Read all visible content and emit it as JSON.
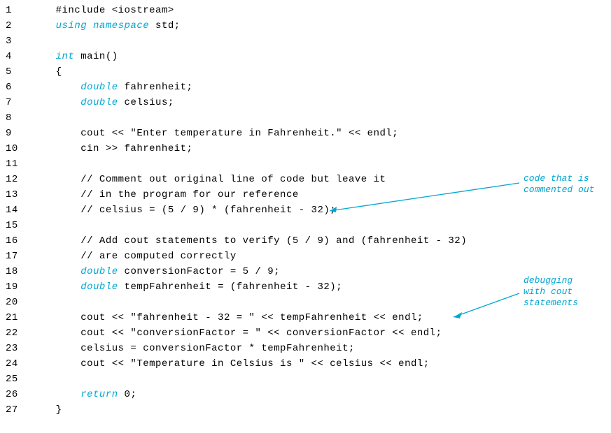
{
  "code": {
    "lines": [
      {
        "n": "1",
        "plain": "#include <iostream>"
      },
      {
        "n": "2",
        "pre": "",
        "kw": "using namespace",
        "post": " std;"
      },
      {
        "n": "3",
        "plain": ""
      },
      {
        "n": "4",
        "pre": "",
        "kw": "int",
        "post": " main()"
      },
      {
        "n": "5",
        "plain": "{"
      },
      {
        "n": "6",
        "pre": "    ",
        "kw": "double",
        "post": " fahrenheit;"
      },
      {
        "n": "7",
        "pre": "    ",
        "kw": "double",
        "post": " celsius;"
      },
      {
        "n": "8",
        "plain": ""
      },
      {
        "n": "9",
        "plain": "    cout << \"Enter temperature in Fahrenheit.\" << endl;"
      },
      {
        "n": "10",
        "plain": "    cin >> fahrenheit;"
      },
      {
        "n": "11",
        "plain": ""
      },
      {
        "n": "12",
        "plain": "    // Comment out original line of code but leave it"
      },
      {
        "n": "13",
        "plain": "    // in the program for our reference"
      },
      {
        "n": "14",
        "plain": "    // celsius = (5 / 9) * (fahrenheit - 32);"
      },
      {
        "n": "15",
        "plain": ""
      },
      {
        "n": "16",
        "plain": "    // Add cout statements to verify (5 / 9) and (fahrenheit - 32)"
      },
      {
        "n": "17",
        "plain": "    // are computed correctly"
      },
      {
        "n": "18",
        "pre": "    ",
        "kw": "double",
        "post": " conversionFactor = 5 / 9;"
      },
      {
        "n": "19",
        "pre": "    ",
        "kw": "double",
        "post": " tempFahrenheit = (fahrenheit - 32);"
      },
      {
        "n": "20",
        "plain": ""
      },
      {
        "n": "21",
        "plain": "    cout << \"fahrenheit - 32 = \" << tempFahrenheit << endl;"
      },
      {
        "n": "22",
        "plain": "    cout << \"conversionFactor = \" << conversionFactor << endl;"
      },
      {
        "n": "23",
        "plain": "    celsius = conversionFactor * tempFahrenheit;"
      },
      {
        "n": "24",
        "plain": "    cout << \"Temperature in Celsius is \" << celsius << endl;"
      },
      {
        "n": "25",
        "plain": ""
      },
      {
        "n": "26",
        "pre": "    ",
        "kw": "return",
        "post": " 0;"
      },
      {
        "n": "27",
        "plain": "}"
      }
    ]
  },
  "annotations": {
    "a1_line1": "code that is",
    "a1_line2": "commented out",
    "a2_line1": "debugging",
    "a2_line2": "with cout",
    "a2_line3": "statements"
  },
  "colors": {
    "accent": "#00A7D1"
  }
}
